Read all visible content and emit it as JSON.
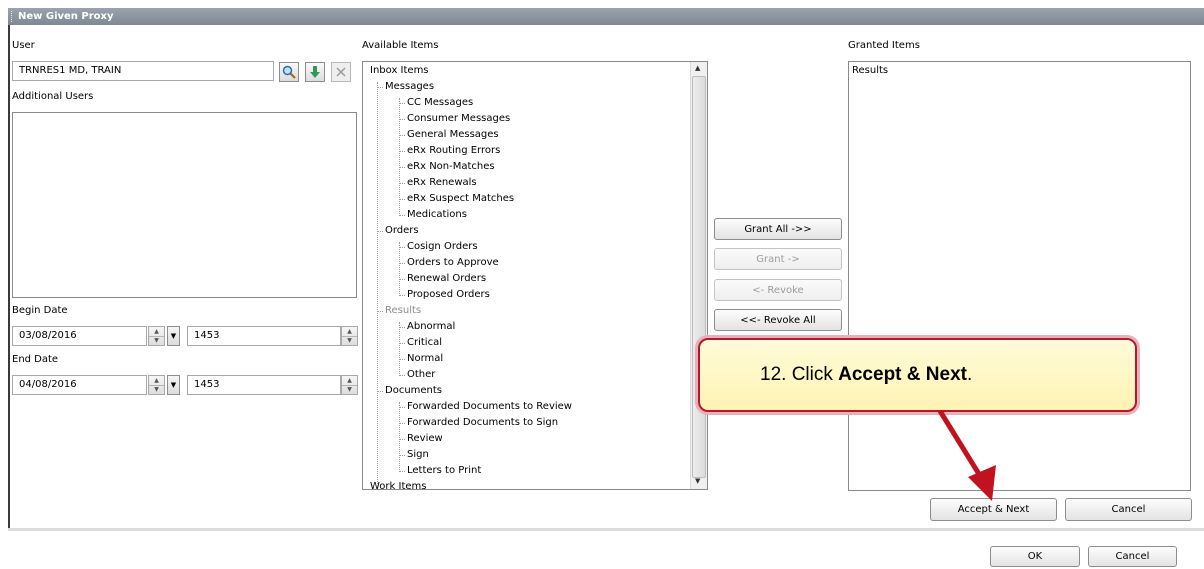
{
  "dialog": {
    "title": "New Given Proxy"
  },
  "user": {
    "label": "User",
    "value": "TRNRES1 MD, TRAIN",
    "additional_users_label": "Additional Users"
  },
  "dates": {
    "begin_label": "Begin Date",
    "begin_date": "03/08/2016",
    "begin_time": "1453",
    "end_label": "End Date",
    "end_date": "04/08/2016",
    "end_time": "1453"
  },
  "available": {
    "label": "Available Items",
    "tree": {
      "inbox": "Inbox Items",
      "messages": "Messages",
      "messages_items": [
        "CC Messages",
        "Consumer Messages",
        "General Messages",
        "eRx Routing Errors",
        "eRx Non-Matches",
        "eRx Renewals",
        "eRx Suspect Matches",
        "Medications"
      ],
      "orders": "Orders",
      "orders_items": [
        "Cosign Orders",
        "Orders to Approve",
        "Renewal Orders",
        "Proposed Orders"
      ],
      "results": "Results",
      "results_items": [
        "Abnormal",
        "Critical",
        "Normal",
        "Other"
      ],
      "documents": "Documents",
      "documents_items": [
        "Forwarded Documents to Review",
        "Forwarded Documents to Sign",
        "Review",
        "Sign",
        "Letters to Print"
      ],
      "work_items": "Work Items"
    }
  },
  "transfer": {
    "grant_all": "Grant All ->>",
    "grant": "Grant ->",
    "revoke": "<- Revoke",
    "revoke_all": "<<- Revoke All"
  },
  "granted": {
    "label": "Granted Items",
    "items": [
      "Results"
    ]
  },
  "actions": {
    "accept_next": "Accept & Next",
    "cancel": "Cancel",
    "ok": "OK",
    "outer_cancel": "Cancel"
  },
  "callout": {
    "prefix": "12. Click ",
    "bold": "Accept & Next",
    "suffix": "."
  },
  "colors": {
    "callout_border": "#b5172f",
    "callout_fill": "#fff6c4",
    "arrow": "#c0121f",
    "titlebar": "#8b939c"
  },
  "icons": [
    "search-icon",
    "download-arrow-icon",
    "clear-x-icon",
    "spin-up-icon",
    "spin-down-icon",
    "dropdown-icon",
    "scroll-up-icon",
    "scroll-down-icon"
  ]
}
